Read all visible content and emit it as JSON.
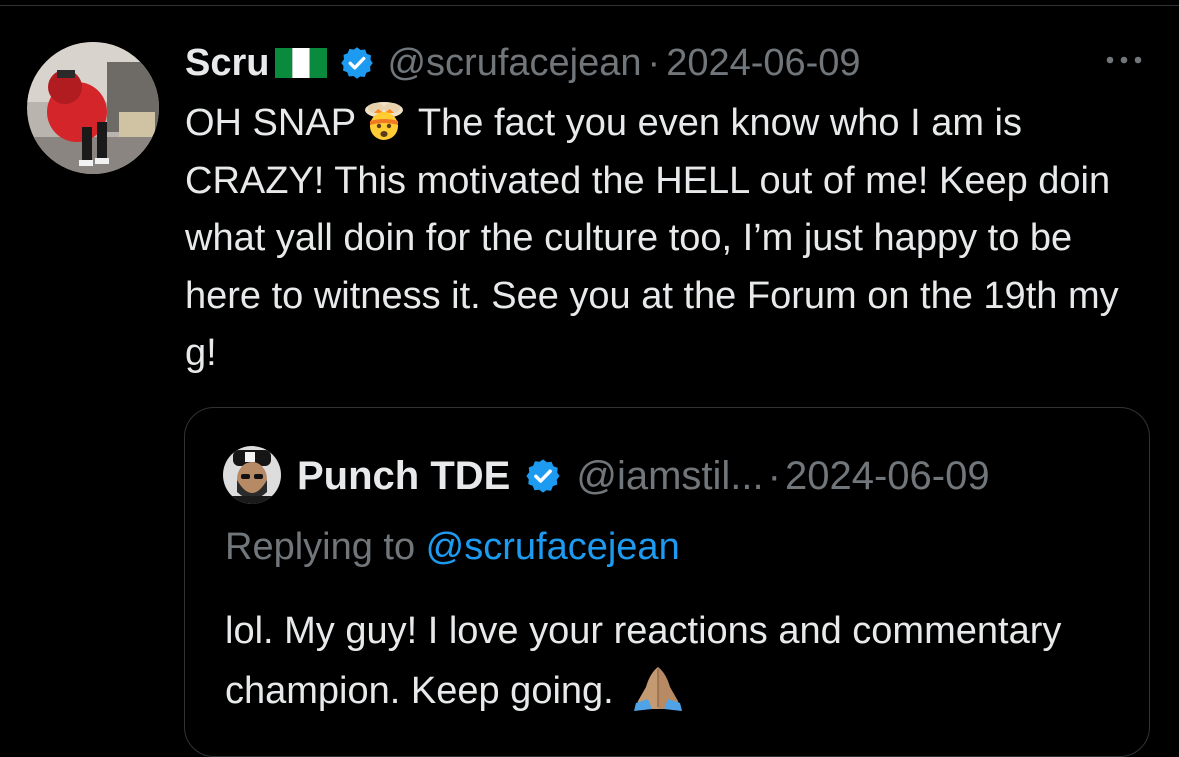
{
  "tweet": {
    "author_name": "Scru",
    "handle": "@scrufacejean",
    "separator": "·",
    "date": "2024-06-09",
    "text_part1": "OH SNAP",
    "text_part2": " The fact you even know who I am is CRAZY! This motivated the HELL out of me! Keep doin what yall doin for the culture too, I’m just happy to be here to witness it. See you at the Forum on the 19th my g!"
  },
  "quoted_tweet": {
    "author_name": "Punch TDE",
    "handle": "@iamstil...",
    "separator": "·",
    "date": "2024-06-09",
    "replying_prefix": "Replying to ",
    "replying_to": "@scrufacejean",
    "text": "lol. My guy! I love your reactions and commentary champion. Keep going."
  },
  "icons": {
    "flag": "nigeria-flag-icon",
    "verified": "verified-badge-icon",
    "more": "more-options-icon",
    "emoji_1": "exploding-head-emoji",
    "emoji_2": "folded-hands-emoji"
  },
  "colors": {
    "background": "#000000",
    "text": "#e7e9ea",
    "muted": "#71767b",
    "link": "#1d9bf0",
    "verified": "#1d9bf0",
    "border": "#2f3336"
  }
}
